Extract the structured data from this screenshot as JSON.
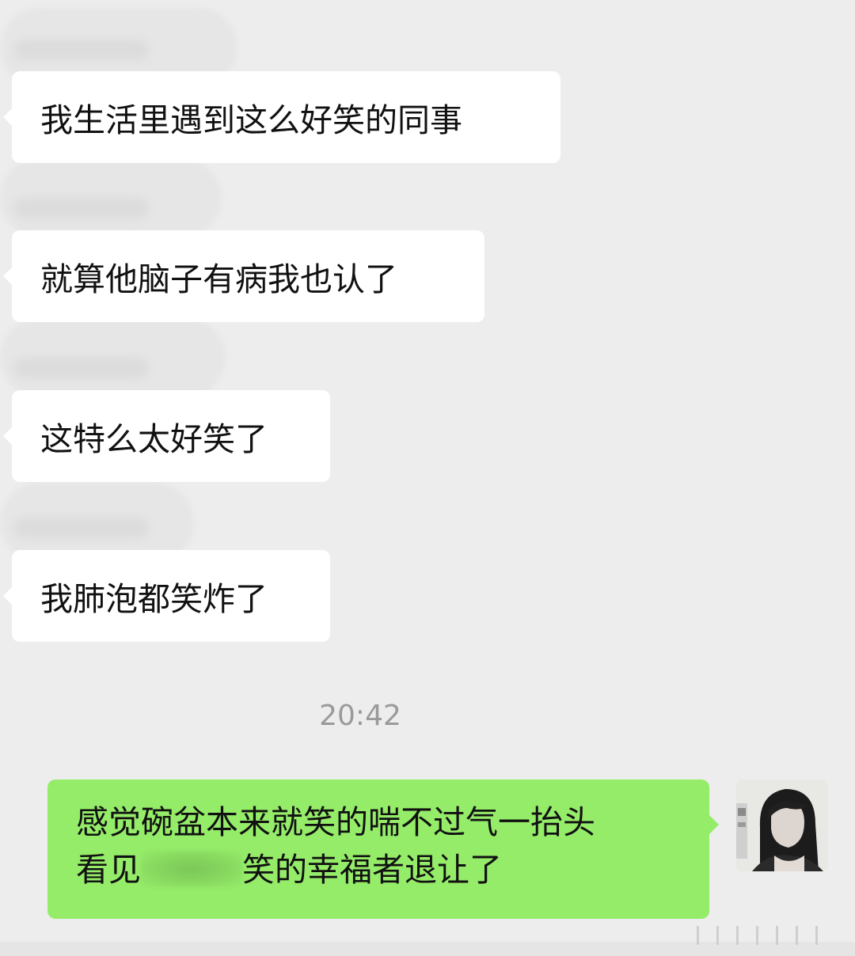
{
  "messages_in": [
    {
      "text": "我生活里遇到这么好笑的同事"
    },
    {
      "text": "就算他脑子有病我也认了"
    },
    {
      "text": "这特么太好笑了"
    },
    {
      "text": "我肺泡都笑炸了"
    }
  ],
  "timestamp": "20:42",
  "message_out": {
    "line1": "感觉碗盆本来就笑的喘不过气一抬头",
    "line2_prefix": "看见",
    "line2_suffix": "笑的幸福者退让了"
  },
  "colors": {
    "background": "#ededed",
    "incoming_bubble": "#ffffff",
    "outgoing_bubble": "#95ec69"
  }
}
